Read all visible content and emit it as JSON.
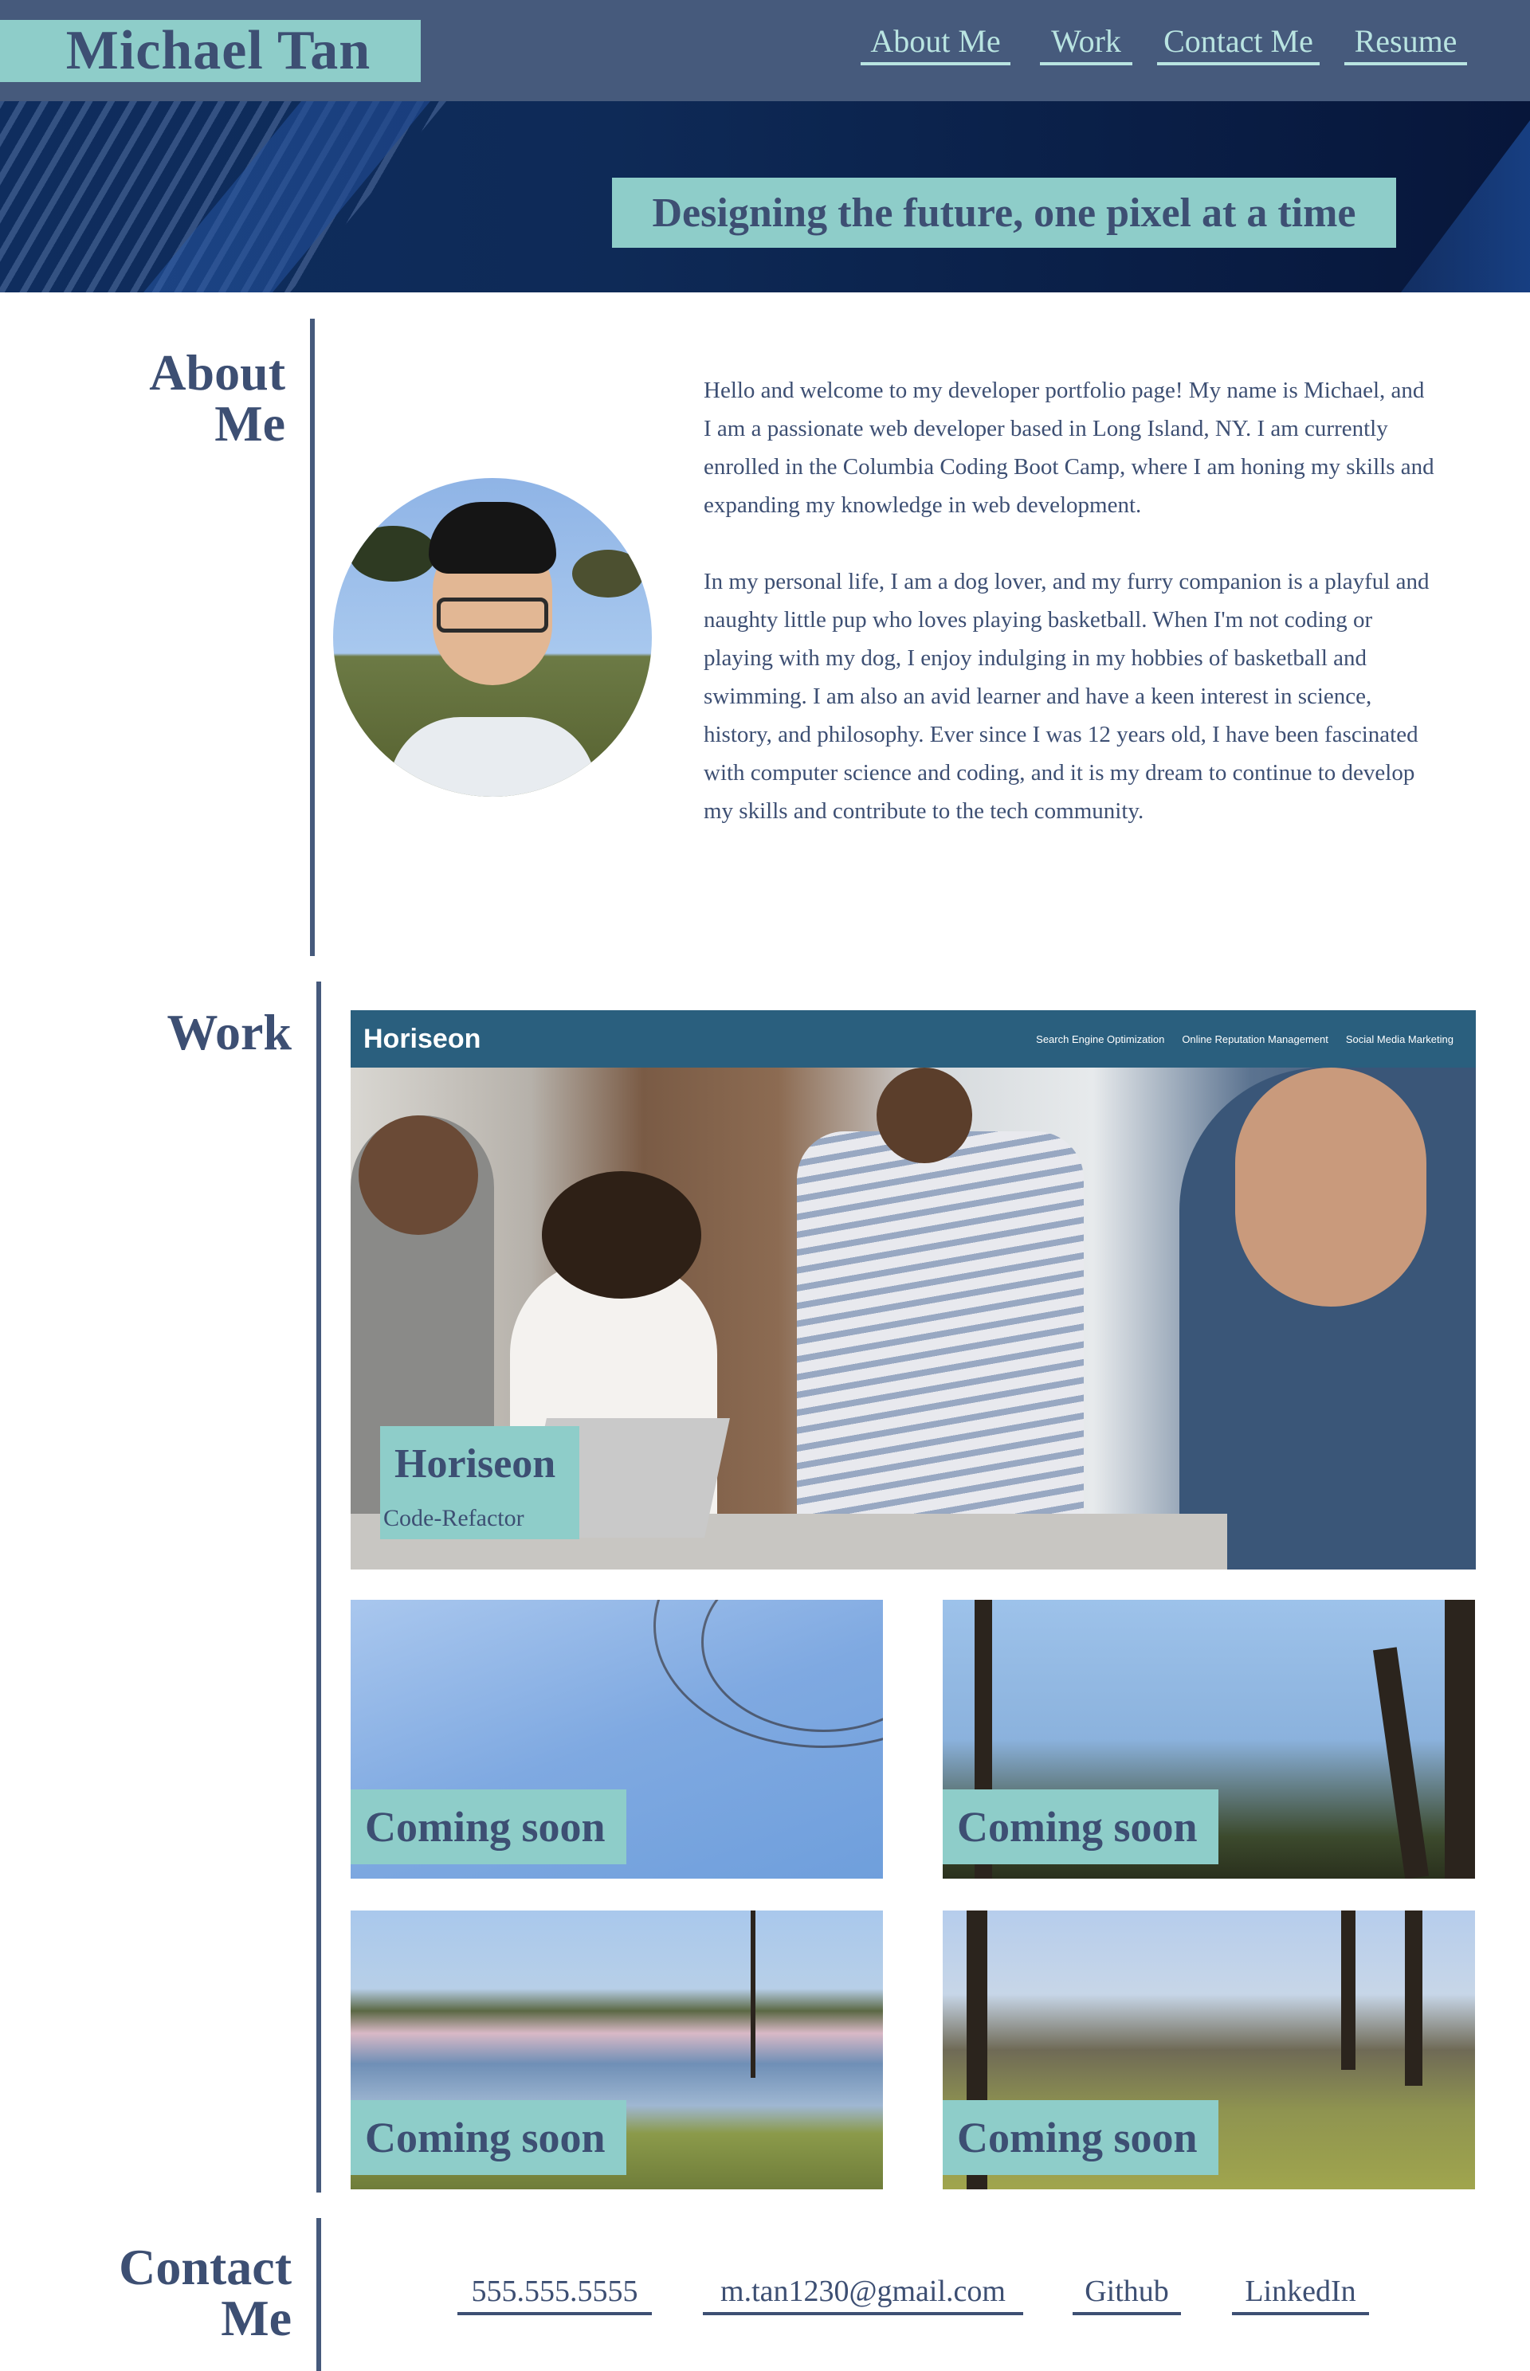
{
  "header": {
    "name": "Michael Tan",
    "nav": [
      "About Me",
      "Work",
      "Contact Me",
      "Resume"
    ]
  },
  "hero": {
    "tagline": "Designing the future, one pixel at a time"
  },
  "about": {
    "title_line1": "About",
    "title_line2": "Me",
    "paragraphs": [
      "Hello and welcome to my developer portfolio page! My name is Michael, and I am a passionate web developer based in Long Island, NY. I am currently enrolled in the Columbia Coding Boot Camp, where I am honing my skills and expanding my knowledge in web development.",
      "In my personal life, I am a dog lover, and my furry companion is a playful and naughty little pup who loves playing basketball. When I'm not coding or playing with my dog, I enjoy indulging in my hobbies of basketball and swimming. I am also an avid learner and have a keen interest in science, history, and philosophy. Ever since I was 12 years old, I have been fascinated with computer science and coding, and it is my dream to continue to develop my skills and contribute to the tech community."
    ]
  },
  "work": {
    "title": "Work",
    "featured": {
      "site_logo": "Horiseon",
      "site_nav": [
        "Search Engine Optimization",
        "Online Reputation Management",
        "Social Media Marketing"
      ],
      "title": "Horiseon",
      "subtitle": "Code-Refactor"
    },
    "tiles": [
      "Coming soon",
      "Coming soon",
      "Coming soon",
      "Coming soon"
    ]
  },
  "contact": {
    "title_line1": "Contact",
    "title_line2": "Me",
    "links": [
      "555.555.5555",
      "m.tan1230@gmail.com",
      "Github",
      "LinkedIn"
    ]
  },
  "colors": {
    "header_bg": "#465a7c",
    "accent_teal": "#8ecdc9",
    "text_navy": "#3d4f73",
    "hero_bg": "#0e2a57"
  }
}
